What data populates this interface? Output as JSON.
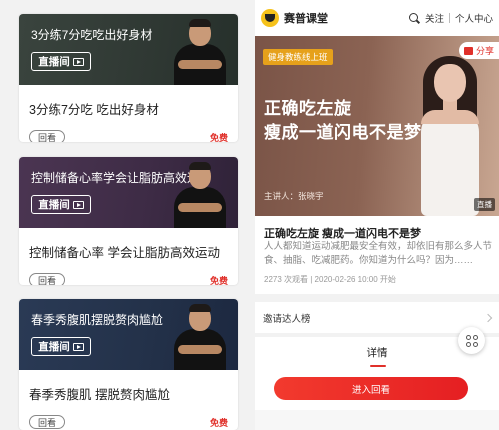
{
  "courses": [
    {
      "banner_title": "3分练7分吃吃出好身材",
      "live_label": "直播间",
      "title": "3分练7分吃 吃出好身材",
      "replay_label": "回看",
      "price_label": "免费"
    },
    {
      "banner_title": "控制储备心率学会让脂肪高效运动",
      "live_label": "直播间",
      "title": "控制储备心率 学会让脂肪高效运动",
      "replay_label": "回看",
      "price_label": "免费"
    },
    {
      "banner_title": "春季秀腹肌摆脱赘肉尴尬",
      "live_label": "直播间",
      "title": "春季秀腹肌 摆脱赘肉尴尬",
      "replay_label": "回看",
      "price_label": "免费"
    }
  ],
  "header": {
    "brand": "赛普课堂",
    "follow_label": "关注",
    "user_center_label": "个人中心",
    "logo_icon": "smiley-logo-icon",
    "search_icon": "search-icon"
  },
  "hero": {
    "tag": "健身教练线上班",
    "share_label": "分享",
    "title_line1": "正确吃左旋",
    "title_line2": "瘦成一道闪电不是梦",
    "speaker": "主讲人：张晓宇",
    "live_corner": "直播"
  },
  "detail": {
    "title": "正确吃左旋 瘦成一道闪电不是梦",
    "description": "人人都知道运动减肥最安全有效，却依旧有那么多人节食、抽脂、吃减肥药。你知道为什么吗？因为……",
    "meta": "2273 次观看 | 2020-02-26 10:00 开始",
    "invite_label": "邀请达人榜",
    "tab_label": "详情",
    "cta_label": "进入回看"
  },
  "colors": {
    "accent_red": "#e0302a",
    "tag_orange": "#e6a11b",
    "logo_yellow": "#f6c21b"
  }
}
